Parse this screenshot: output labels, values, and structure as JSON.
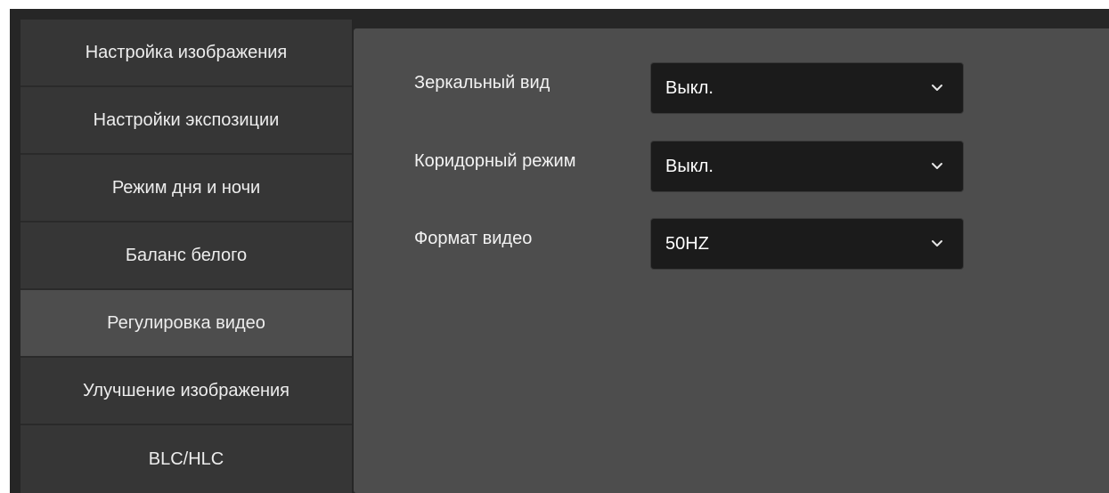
{
  "sidebar": {
    "items": [
      {
        "label": "Настройка изображения"
      },
      {
        "label": "Настройки экспозиции"
      },
      {
        "label": "Режим дня и ночи"
      },
      {
        "label": "Баланс белого"
      },
      {
        "label": "Регулировка видео"
      },
      {
        "label": "Улучшение изображения"
      },
      {
        "label": "BLC/HLC"
      }
    ],
    "active_item": "Регулировка видео"
  },
  "settings": {
    "mirror": {
      "label": "Зеркальный вид",
      "value": "Выкл."
    },
    "corridor": {
      "label": "Коридорный режим",
      "value": "Выкл."
    },
    "video_format": {
      "label": "Формат видео",
      "value": "50HZ"
    }
  },
  "icons": {
    "dropdown": "chevron-down-icon"
  },
  "colors": {
    "panel_background": "#262626",
    "sidebar_item": "#363636",
    "sidebar_item_active": "#4d4d4d",
    "content_background": "#4d4d4d",
    "select_background": "#1b1b1b",
    "text": "#ededed"
  }
}
